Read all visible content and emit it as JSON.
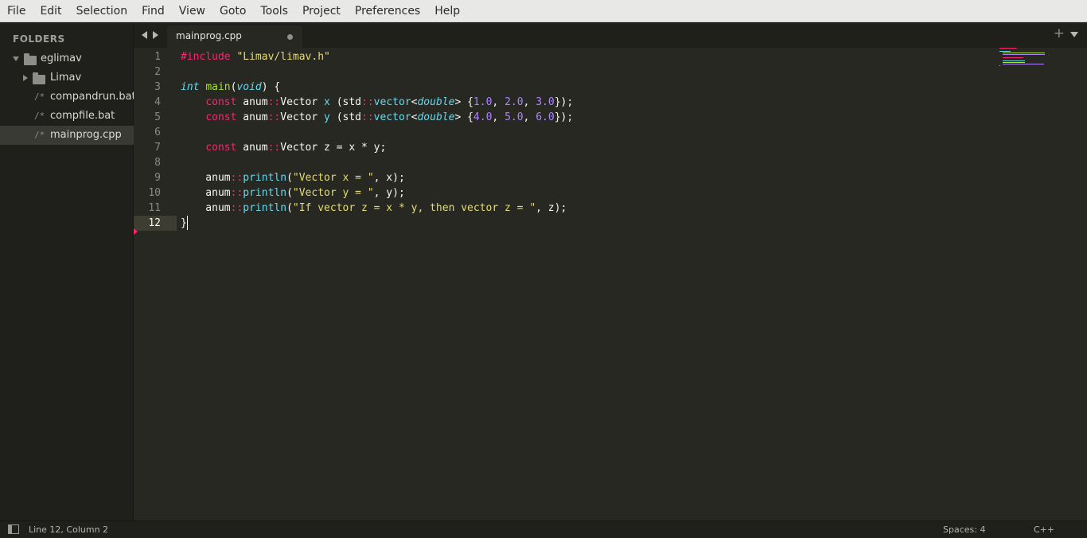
{
  "menu": [
    "File",
    "Edit",
    "Selection",
    "Find",
    "View",
    "Goto",
    "Tools",
    "Project",
    "Preferences",
    "Help"
  ],
  "sidebar": {
    "header": "FOLDERS",
    "root": "eglimav",
    "items": [
      {
        "label": "Limav",
        "kind": "folder",
        "icon": "folder-icon"
      },
      {
        "label": "compandrun.bat",
        "kind": "file",
        "icon": "/*"
      },
      {
        "label": "compfile.bat",
        "kind": "file",
        "icon": "/*"
      },
      {
        "label": "mainprog.cpp",
        "kind": "file",
        "icon": "/*",
        "selected": true
      }
    ]
  },
  "tabs": [
    {
      "title": "mainprog.cpp",
      "active": true,
      "dirty": true
    }
  ],
  "editor": {
    "line_numbers": [
      "1",
      "2",
      "3",
      "4",
      "5",
      "6",
      "7",
      "8",
      "9",
      "10",
      "11",
      "12"
    ],
    "current_line": "12",
    "code_lines": [
      "#include \"Limav/limav.h\"",
      "",
      "int main(void) {",
      "    const anum::Vector x (std::vector<double> {1.0, 2.0, 3.0});",
      "    const anum::Vector y (std::vector<double> {4.0, 5.0, 6.0});",
      "",
      "    const anum::Vector z = x * y;",
      "",
      "    anum::println(\"Vector x = \", x);",
      "    anum::println(\"Vector y = \", y);",
      "    anum::println(\"If vector z = x * y, then vector z = \", z);",
      "}"
    ]
  },
  "status": {
    "position": "Line 12, Column 2",
    "indent": "Spaces: 4",
    "syntax": "C++"
  },
  "colors": {
    "background": "#272822",
    "keyword": "#f92672",
    "string": "#e6db74",
    "type": "#66d9ef",
    "function": "#a6e22e",
    "number": "#ae81ff"
  }
}
